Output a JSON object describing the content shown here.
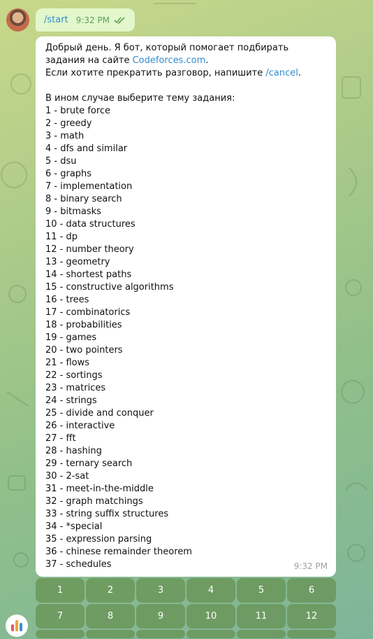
{
  "outgoing": {
    "command": "/start",
    "time": "9:32 PM"
  },
  "incoming": {
    "greeting_before_link": "Добрый день. Я бот, который помогает подбирать задания на сайте ",
    "site_link": "Codeforces.com",
    "greeting_after_link": ".",
    "stop_before_link": "Если хотите прекратить разговор, напишите ",
    "cancel_link": "/cancel",
    "stop_after_link": ".",
    "choose_prompt": "В ином случае выберите тему задания:",
    "topics": [
      "1 - brute force",
      "2 - greedy",
      "3 - math",
      "4 - dfs and similar",
      "5 - dsu",
      "6 - graphs",
      "7 - implementation",
      "8 - binary search",
      "9 - bitmasks",
      "10 - data structures",
      "11 - dp",
      "12 - number theory",
      "13 - geometry",
      "14 - shortest paths",
      "15 - constructive algorithms",
      "16 - trees",
      "17 - combinatorics",
      "18 - probabilities",
      "19 - games",
      "20 - two pointers",
      "21 - flows",
      "22 - sortings",
      "23 - matrices",
      "24 - strings",
      "25 - divide and conquer",
      "26 - interactive",
      "27 - fft",
      "28 - hashing",
      "29 - ternary search",
      "30 - 2-sat",
      "31 - meet-in-the-middle",
      "32 - graph matchings",
      "33 - string suffix structures",
      "34 - *special",
      "35 - expression parsing",
      "36 - chinese remainder theorem",
      "37 - schedules"
    ],
    "time": "9:32 PM"
  },
  "keyboard": {
    "buttons": [
      "1",
      "2",
      "3",
      "4",
      "5",
      "6",
      "7",
      "8",
      "9",
      "10",
      "11",
      "12"
    ]
  },
  "colors": {
    "outgoing_bubble": "#e2f7cb",
    "link": "#2f8bd0",
    "keyboard_button": "#679152"
  }
}
